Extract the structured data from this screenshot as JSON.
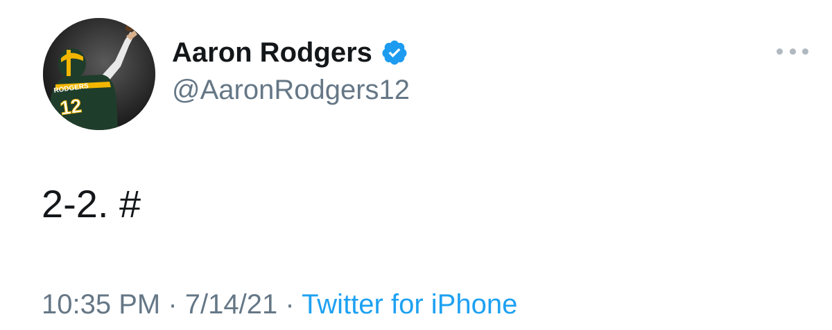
{
  "tweet": {
    "display_name": "Aaron Rodgers",
    "handle": "@AaronRodgers12",
    "verified": true,
    "avatar": {
      "jersey_name": "RODGERS",
      "jersey_number": "12"
    },
    "text": "2-2. #",
    "time": "10:35 PM",
    "separator": " · ",
    "date": "7/14/21",
    "source": "Twitter for iPhone"
  },
  "colors": {
    "name_text": "#14171a",
    "secondary_text": "#657786",
    "link_blue": "#1da1f2",
    "verified_blue": "#1d9bf0",
    "more_dots": "#b0b8c0"
  },
  "icons": {
    "verified": "verified-badge-icon",
    "more": "more-options-icon"
  }
}
